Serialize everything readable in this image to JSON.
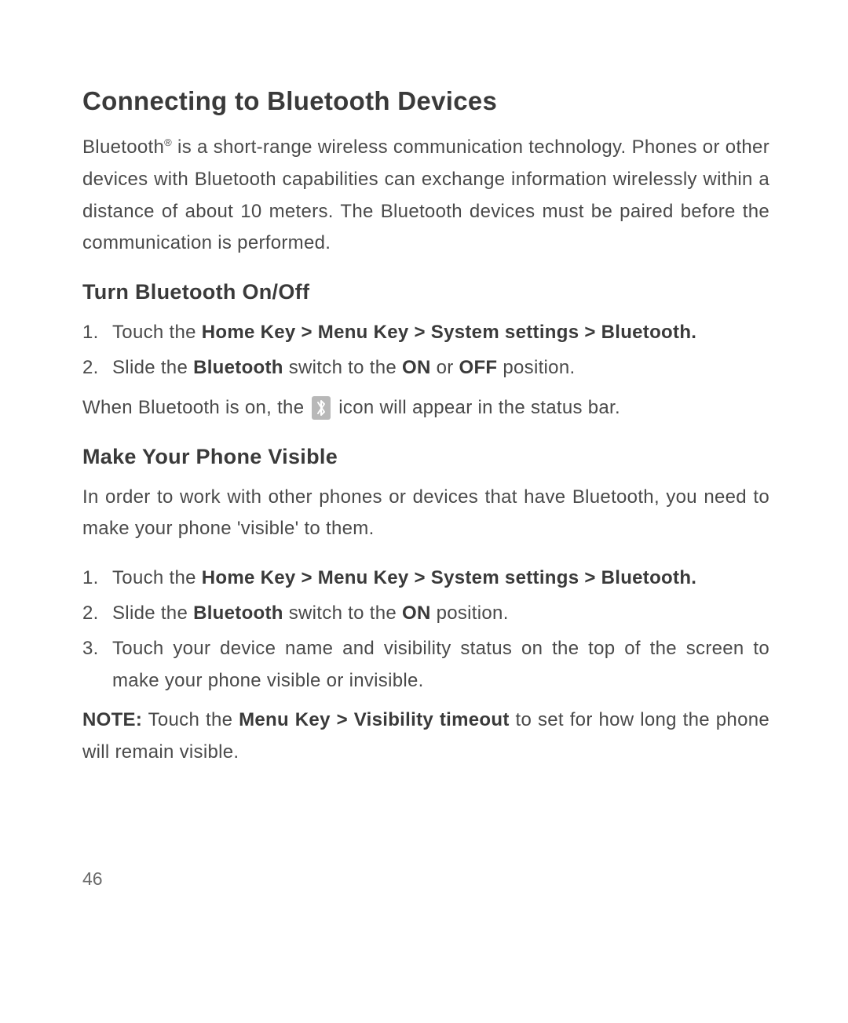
{
  "title": "Connecting to Bluetooth Devices",
  "intro": {
    "part1": "Bluetooth",
    "sup": "®",
    "part2": " is a short-range wireless communication technology. Phones or other devices with Bluetooth capabilities can exchange information wirelessly within a distance of about 10 meters. The Bluetooth devices must be paired before the communication is performed."
  },
  "section1": {
    "heading": "Turn Bluetooth On/Off",
    "items": [
      {
        "num": "1.",
        "pre": "Touch the ",
        "bold": "Home Key > Menu Key > System settings > Bluetooth."
      },
      {
        "num": "2.",
        "pre": "Slide the ",
        "bold1": "Bluetooth",
        "mid": " switch to the ",
        "bold2": "ON",
        "mid2": " or ",
        "bold3": "OFF",
        "post": " position."
      }
    ],
    "bodytext": {
      "pre": "When Bluetooth is on, the ",
      "post": " icon will appear in the status bar."
    }
  },
  "section2": {
    "heading": "Make Your Phone Visible",
    "intro": "In order to work with other phones or devices that have Bluetooth, you need to make your phone 'visible' to them.",
    "items": [
      {
        "num": "1.",
        "pre": "Touch the ",
        "bold": "Home Key > Menu Key > System settings > Bluetooth."
      },
      {
        "num": "2.",
        "pre": "Slide the ",
        "bold1": "Bluetooth",
        "mid": " switch to the ",
        "bold2": "ON",
        "post": " position."
      },
      {
        "num": "3.",
        "text": "Touch your device name and visibility status on the top of the screen to make your phone visible or invisible."
      }
    ],
    "note": {
      "label": "NOTE:",
      "pre": " Touch the ",
      "bold": "Menu Key > Visibility timeout",
      "post": " to set for how long the phone will remain visible."
    }
  },
  "pageNumber": "46"
}
